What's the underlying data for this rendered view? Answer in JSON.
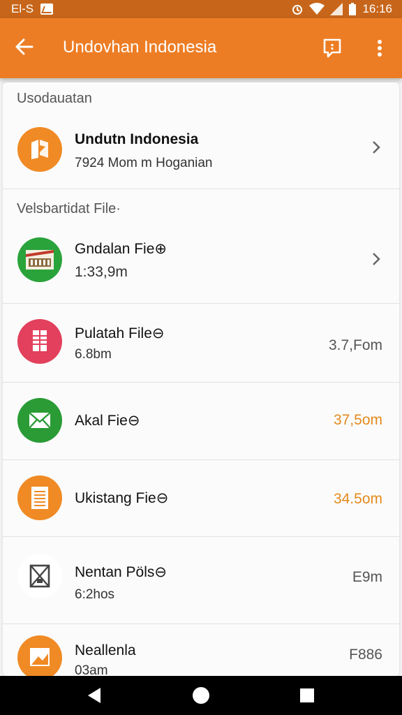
{
  "status_bar": {
    "left_text": "El-S",
    "time": "16:16"
  },
  "app_bar": {
    "back_icon": "arrow-left-icon",
    "title": "Undovhan Indonesia",
    "actions": [
      "feedback-icon",
      "more-vert-icon"
    ]
  },
  "sections": {
    "first": {
      "title": "Usodauatan",
      "item": {
        "name": "Undutn Indonesia",
        "sub": "7924 Mom m Hoganian",
        "icon": "map-icon",
        "color": "#f08a24"
      }
    },
    "second": {
      "title": "Velsbartidat File·",
      "items": [
        {
          "name": "Gndalan Fie⊕",
          "sub": "1:33,9m",
          "meta": "",
          "icon": "image-icon",
          "color": "#2aa33a"
        },
        {
          "name": "Pulatah File⊖",
          "sub": "6.8bm",
          "meta": "3.7,Fom",
          "icon": "spreadsheet-icon",
          "color": "#e2405c"
        },
        {
          "name": "Akal Fie⊖",
          "sub": "",
          "meta": "37,5om",
          "icon": "mail-icon",
          "color": "#2a9b35"
        },
        {
          "name": "Ukistang Fie⊖",
          "sub": "",
          "meta": "34.5om",
          "icon": "document-icon",
          "color": "#f08a24"
        },
        {
          "name": "Nentan Pöls⊖",
          "sub": "6:2hos",
          "meta": "E9m",
          "icon": "broken-file-icon",
          "color": "#ffffff"
        },
        {
          "name": "Neallenla",
          "sub": "03am",
          "meta": "F886",
          "icon": "folder-image-icon",
          "color": "#f08a24"
        }
      ]
    }
  },
  "nav_bar": {
    "buttons": [
      "back-triangle-icon",
      "home-circle-icon",
      "recents-square-icon"
    ]
  }
}
